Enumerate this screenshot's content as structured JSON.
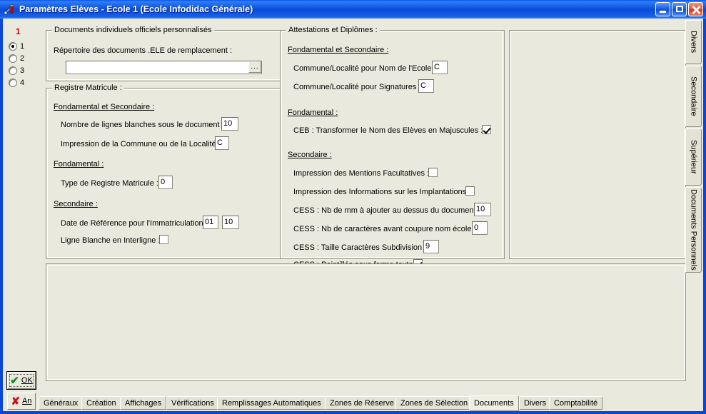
{
  "window": {
    "title": "Paramètres Elèves - Ecole 1 (Ecole Infodidac Générale)",
    "icon": "wrench-tool-icon",
    "controls": {
      "minimize": "minimize-icon",
      "maximize": "maximize-icon",
      "close": "close-icon"
    },
    "titlebar_color": "#0b50e0",
    "client_color": "#eae9dd"
  },
  "sidebar": {
    "current_number": "1",
    "radios": [
      {
        "label": "1",
        "selected": true
      },
      {
        "label": "2",
        "selected": false
      },
      {
        "label": "3",
        "selected": false
      },
      {
        "label": "4",
        "selected": false
      }
    ],
    "ok_button": {
      "label": "OK",
      "icon": "green-check-icon"
    },
    "cancel_button": {
      "label": "An",
      "icon": "red-x-icon"
    }
  },
  "groups": {
    "documents_perso": {
      "title": "Documents individuels officiels personnalisés",
      "repertoire_label": "Répertoire des documents .ELE de remplacement :",
      "repertoire_value": "",
      "browse_label": "..."
    },
    "registre": {
      "title": "Registre Matricule :",
      "head_fond_sec": "Fondamental et Secondaire :",
      "lignes_blanches_label": "Nombre de lignes blanches sous le document :",
      "lignes_blanches_value": "10",
      "commune_label": "Impression de la Commune ou de la Localité :",
      "commune_value": "C",
      "head_fond": "Fondamental :",
      "type_registre_label": "Type de Registre Matricule :",
      "type_registre_value": "0",
      "head_sec": "Secondaire :",
      "date_ref_label": "Date de Référence pour l'Immatriculation :",
      "date_ref_day": "01",
      "date_ref_month": "10",
      "ligne_blanche_label": "Ligne Blanche en Interligne :",
      "ligne_blanche_checked": false
    },
    "attestations": {
      "title": "Attestations et Diplômes :",
      "head_fond_sec": "Fondamental et Secondaire :",
      "commune_ecole_label": "Commune/Localité pour Nom de l'Ecole :",
      "commune_ecole_value": "C",
      "commune_sign_label": "Commune/Localité pour Signatures :",
      "commune_sign_value": "C",
      "head_fond": "Fondamental :",
      "ceb_label": "CEB :  Transformer le Nom des Elèves en Majuscules :",
      "ceb_checked": true,
      "head_sec": "Secondaire :",
      "mentions_label": "Impression des Mentions Facultatives :",
      "mentions_checked": false,
      "implantations_label": "Impression des Informations sur les Implantations :",
      "implantations_checked": false,
      "cess_mm_label": "CESS : Nb de mm à ajouter au dessus du document :",
      "cess_mm_value": "10",
      "cess_carac_label": "CESS : Nb de caractères avant coupure nom école :",
      "cess_carac_value": "0",
      "cess_taille_label": "CESS : Taille Caractères Subdivision :",
      "cess_taille_value": "9",
      "cess_point_label": "CESS : Pointillés sous forme texte :",
      "cess_point_checked": true
    },
    "empty_right": {
      "title": ""
    },
    "empty_bottom": {
      "title": ""
    }
  },
  "vertical_tabs": [
    {
      "label": "Divers",
      "active": false
    },
    {
      "label": "Secondaire",
      "active": false
    },
    {
      "label": "Supérieur",
      "active": false
    },
    {
      "label": "Documents Personnels",
      "active": false
    }
  ],
  "bottom_tabs": [
    {
      "label": "Généraux",
      "active": false
    },
    {
      "label": "Création",
      "active": false
    },
    {
      "label": "Affichages",
      "active": false
    },
    {
      "label": "Vérifications",
      "active": false
    },
    {
      "label": "Remplissages Automatiques",
      "active": false
    },
    {
      "label": "Zones de Réserve",
      "active": false
    },
    {
      "label": "Zones de Sélection",
      "active": false
    },
    {
      "label": "Documents",
      "active": true
    },
    {
      "label": "Divers",
      "active": false
    },
    {
      "label": "Comptabilité",
      "active": false
    }
  ]
}
